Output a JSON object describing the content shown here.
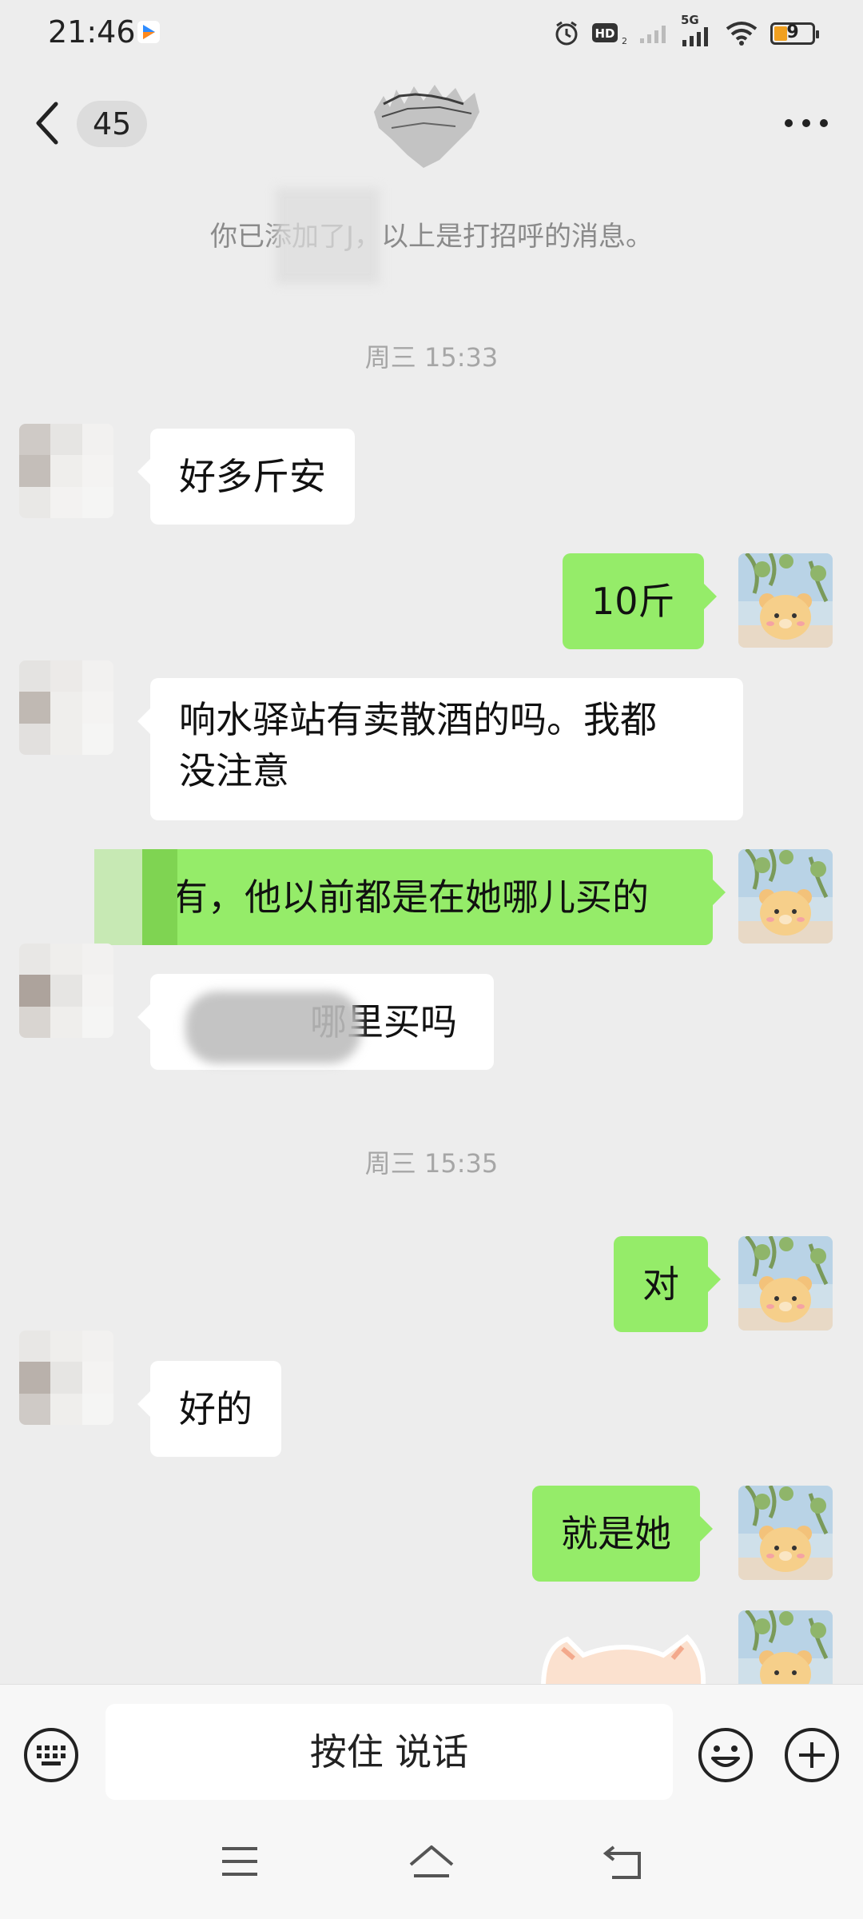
{
  "status_bar": {
    "time": "21:46",
    "network": "5G",
    "hd_label": "HD",
    "battery": "9"
  },
  "header": {
    "unread_count": "45"
  },
  "messages": {
    "system_note": "你已添加了J，以上是打招呼的消息。",
    "timestamp_1": "周三 15:33",
    "m1": "好多斤安",
    "m2": "10斤",
    "m3_line1": "响水驿站有卖散酒的吗。我都",
    "m3_line2": "没注意",
    "m4": "有，他以前都是在她哪儿买的",
    "m5": "哪里买吗",
    "timestamp_2": "周三 15:35",
    "m6": "对",
    "m7": "好的",
    "m8": "就是她"
  },
  "input_bar": {
    "hold_to_talk": "按住 说话"
  },
  "colors": {
    "sent_bubble": "#95ec69",
    "received_bubble": "#ffffff",
    "background": "#ededed"
  },
  "icons": [
    "back-arrow-icon",
    "more-icon",
    "keyboard-icon",
    "emoji-icon",
    "plus-icon",
    "menu-icon",
    "home-icon",
    "return-icon",
    "alarm-icon",
    "wifi-icon",
    "signal-icon"
  ]
}
